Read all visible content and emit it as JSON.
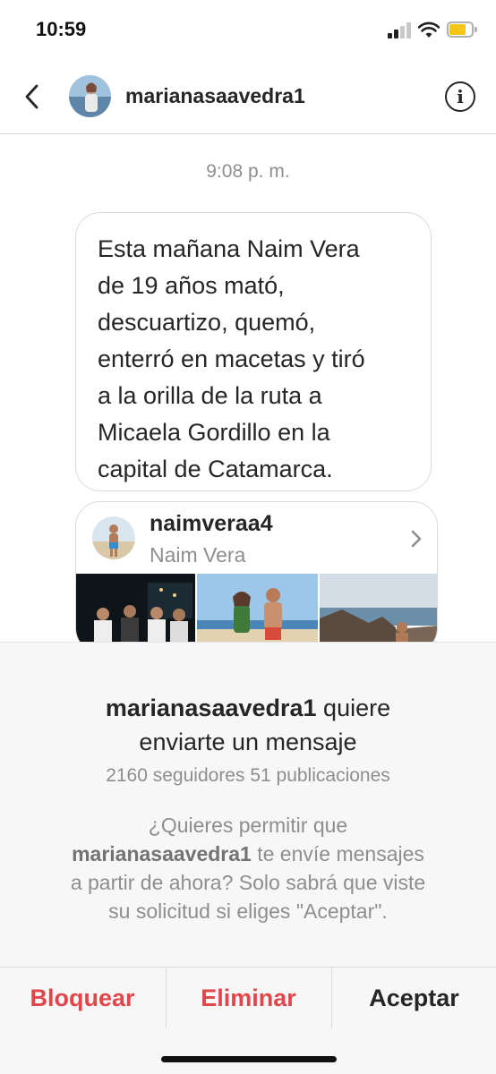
{
  "status_bar": {
    "time": "10:59",
    "battery_color": "#f5c518"
  },
  "header": {
    "username": "marianasaavedra1",
    "info_label": "i"
  },
  "chat": {
    "timestamp": "9:08 p. m.",
    "message_lines": [
      "Esta mañana Naim Vera",
      "de 19 años mató,",
      "descuartizo, quemó,",
      "enterró en macetas y tiró",
      "a la orilla de la ruta a",
      "Micaela Gordillo en la",
      "capital de Catamarca."
    ],
    "shared_profile": {
      "username": "naimveraa4",
      "full_name": "Naim Vera"
    }
  },
  "request": {
    "title_username": "marianasaavedra1",
    "title_rest_1": " quiere",
    "title_line2": "enviarte un mensaje",
    "stats": "2160 seguidores 51 publicaciones",
    "body_line1": "¿Quieres permitir que",
    "body_username": "marianasaavedra1",
    "body_line2_rest": " te envíe mensajes",
    "body_line3": "a partir de ahora? Solo sabrá que viste",
    "body_line4": "su solicitud si eliges \"Aceptar\"."
  },
  "actions": {
    "block": "Bloquear",
    "delete": "Eliminar",
    "accept": "Aceptar"
  },
  "colors": {
    "danger": "#e0464a",
    "text": "#262626",
    "muted": "#8e8e8e"
  },
  "icons": [
    "back-icon",
    "info-icon",
    "chevron-right-icon",
    "signal-icon",
    "wifi-icon",
    "battery-icon"
  ]
}
